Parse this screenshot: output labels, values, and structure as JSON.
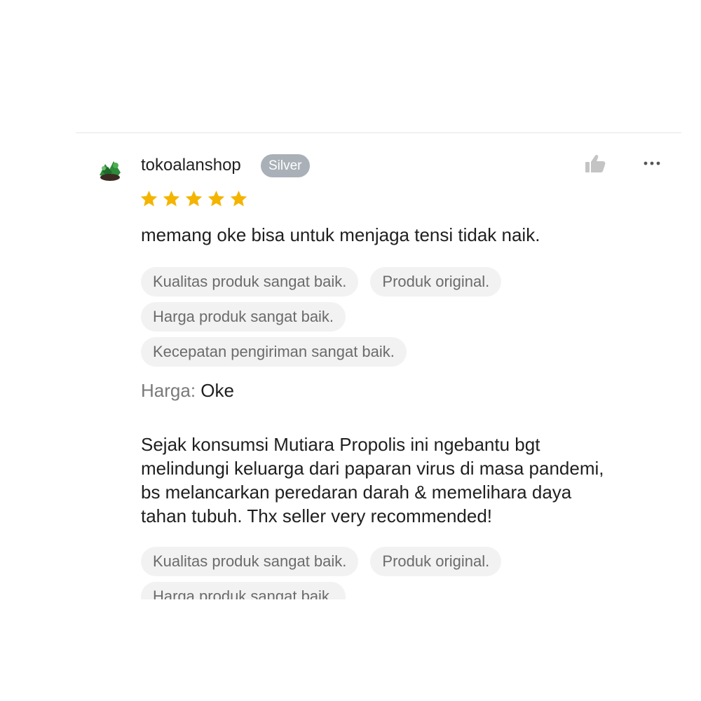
{
  "review": {
    "username": "tokoalanshop",
    "badge": "Silver",
    "rating": 5,
    "icons": {
      "like": "thumbs-up-icon",
      "more": "more-horizontal-icon",
      "star": "star-icon"
    },
    "colors": {
      "star": "#f4b400",
      "badge_bg": "#a9b0b7",
      "chip_bg": "#f2f2f2",
      "chip_text": "#6b6b6b"
    },
    "headline": "memang oke bisa untuk menjaga tensi tidak naik.",
    "tags_first": [
      "Kualitas produk sangat baik.",
      "Produk original.",
      "Harga produk sangat baik.",
      "Kecepatan pengiriman sangat baik."
    ],
    "harga_label": "Harga:",
    "harga_value": "Oke",
    "body_lines": [
      "Sejak konsumsi Mutiara Propolis ini ngebantu bgt",
      "melindungi keluarga dari paparan virus di masa pandemi,",
      "bs melancarkan peredaran darah & memelihara daya",
      "tahan tubuh. Thx seller very recommended!"
    ],
    "tags_second": [
      "Kualitas produk sangat baik.",
      "Produk original.",
      "Harga produk sangat baik."
    ]
  }
}
